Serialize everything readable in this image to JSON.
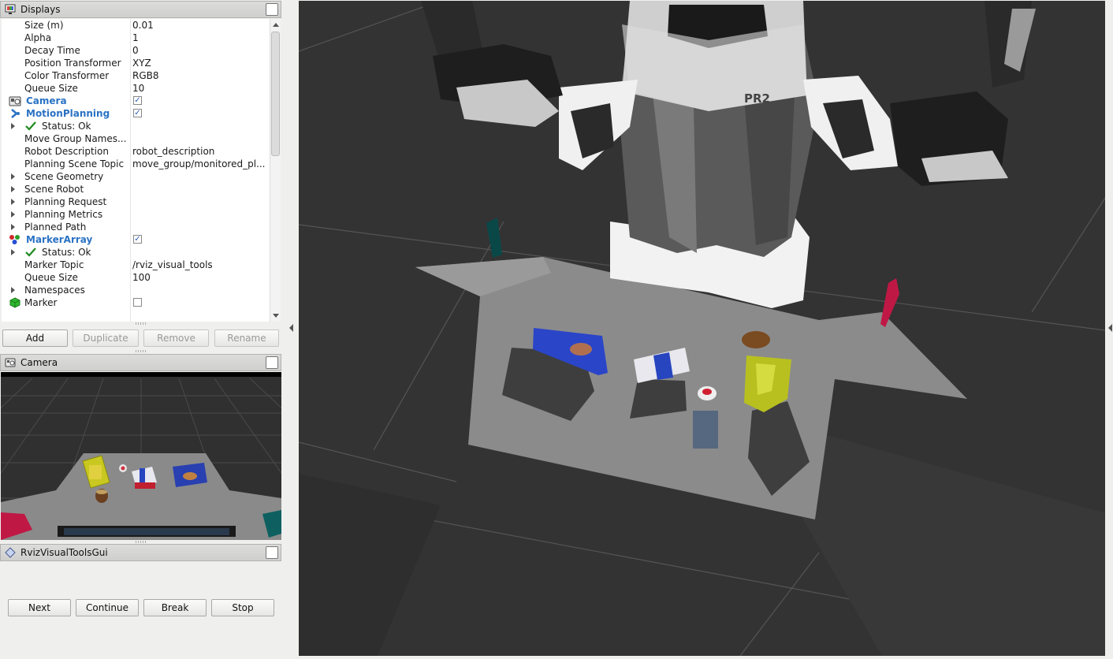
{
  "displays_panel": {
    "title": "Displays",
    "rows": [
      {
        "name": "Size (m)",
        "value": "0.01"
      },
      {
        "name": "Alpha",
        "value": "1"
      },
      {
        "name": "Decay Time",
        "value": "0"
      },
      {
        "name": "Position Transformer",
        "value": "XYZ"
      },
      {
        "name": "Color Transformer",
        "value": "RGB8"
      },
      {
        "name": "Queue Size",
        "value": "10"
      },
      {
        "name": "Camera",
        "checked": "✓"
      },
      {
        "name": "MotionPlanning",
        "checked": "✓"
      },
      {
        "name": "Status: Ok"
      },
      {
        "name": "Move Group Names..."
      },
      {
        "name": "Robot Description",
        "value": "robot_description"
      },
      {
        "name": "Planning Scene Topic",
        "value": "move_group/monitored_pl..."
      },
      {
        "name": "Scene Geometry"
      },
      {
        "name": "Scene Robot"
      },
      {
        "name": "Planning Request"
      },
      {
        "name": "Planning Metrics"
      },
      {
        "name": "Planned Path"
      },
      {
        "name": "MarkerArray",
        "checked": "✓"
      },
      {
        "name": "Status: Ok"
      },
      {
        "name": "Marker Topic",
        "value": "/rviz_visual_tools"
      },
      {
        "name": "Queue Size",
        "value": "100"
      },
      {
        "name": "Namespaces"
      },
      {
        "name": "Marker",
        "checked": ""
      }
    ],
    "buttons": {
      "add": "Add",
      "duplicate": "Duplicate",
      "remove": "Remove",
      "rename": "Rename"
    }
  },
  "camera_panel": {
    "title": "Camera"
  },
  "rviz_tools_panel": {
    "title": "RvizVisualToolsGui",
    "buttons": {
      "next": "Next",
      "continue": "Continue",
      "break": "Break",
      "stop": "Stop"
    }
  },
  "main_view": {
    "robot_label": "PR2"
  },
  "colors": {
    "link_blue": "#2a72c4",
    "status_green": "#1e8a1e",
    "background_3d": "#313131"
  }
}
